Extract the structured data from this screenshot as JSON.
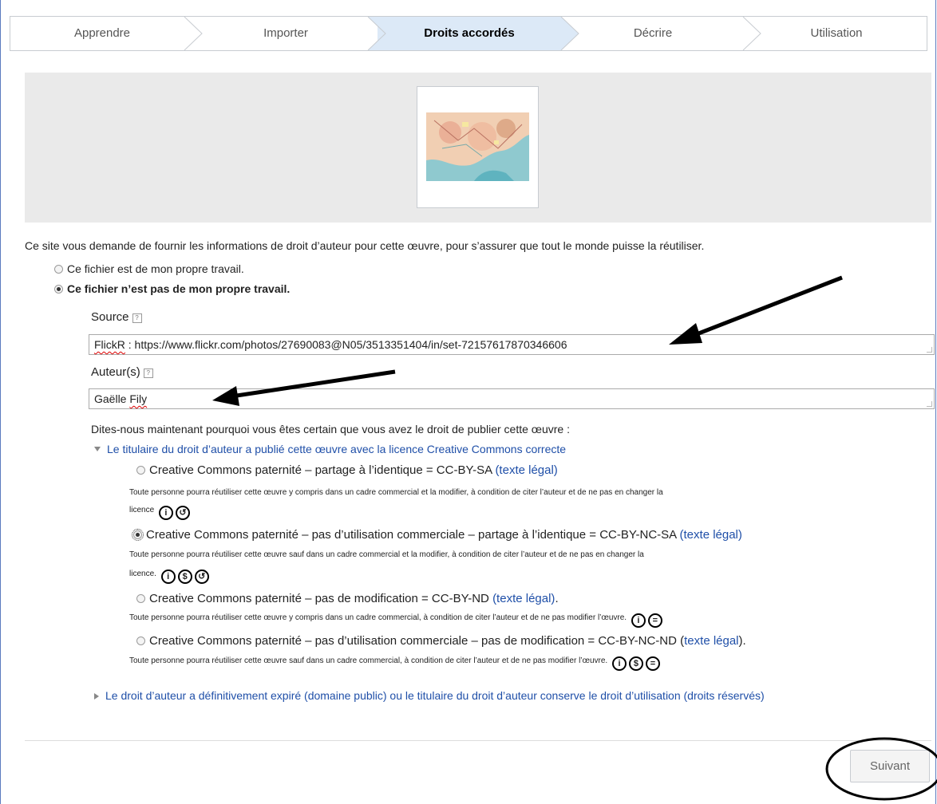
{
  "steps": [
    {
      "label": "Apprendre"
    },
    {
      "label": "Importer"
    },
    {
      "label": "Droits accordés"
    },
    {
      "label": "Décrire"
    },
    {
      "label": "Utilisation"
    }
  ],
  "intro": "Ce site vous demande de fournir les informations de droit d’auteur pour cette œuvre, pour s’assurer que tout le monde puisse la réutiliser.",
  "own_work": "Ce fichier est de mon propre travail.",
  "not_own_work": "Ce fichier n’est pas de mon propre travail.",
  "source": {
    "label": "Source",
    "value_prefix": "FlickR",
    "value_rest": " : https://www.flickr.com/photos/27690083@N05/3513351404/in/set-72157617870346606"
  },
  "authors": {
    "label": "Auteur(s)",
    "value_prefix": "Gaëlle ",
    "value_name": "Fily"
  },
  "why": "Dites-nous maintenant pourquoi vous êtes certain que vous avez le droit de publier cette œuvre :",
  "cc_section": "Le titulaire du droit d’auteur a publié cette œuvre avec la licence Creative Commons correcte",
  "licenses": [
    {
      "title": "Creative Commons paternité – partage à l’identique = CC-BY-SA",
      "link": "(texte légal)",
      "desc1": "Toute personne pourra réutiliser cette œuvre y compris dans un cadre commercial et la modifier, à condition de citer l’auteur et de ne pas en changer la",
      "desc2": "licence"
    },
    {
      "title": "Creative Commons paternité – pas d’utilisation commerciale – partage à l’identique = CC-BY-NC-SA",
      "link": "(texte légal)",
      "desc1": "Toute personne pourra réutiliser cette œuvre sauf dans un cadre commercial et la modifier, à condition de citer l’auteur et de ne pas en changer la",
      "desc2": "licence."
    },
    {
      "title": "Creative Commons paternité – pas de modification = CC-BY-ND",
      "link": "(texte légal)",
      "after": ".",
      "desc1": "Toute personne pourra réutiliser cette œuvre y compris dans un cadre commercial, à condition de citer l’auteur et de ne pas modifier l’œuvre."
    },
    {
      "title": "Creative Commons paternité – pas d’utilisation commerciale – pas de modification = CC-BY-NC-ND",
      "link_open": "(",
      "link": "texte légal",
      "after": ").",
      "desc1": "Toute personne pourra réutiliser cette œuvre sauf dans un cadre commercial, à condition de citer l’auteur et de ne pas modifier l’œuvre."
    }
  ],
  "pd_section": "Le droit d’auteur a définitivement expiré (domaine public) ou le titulaire du droit d’auteur conserve le droit d’utilisation (droits réservés)",
  "next_button": "Suivant",
  "icons": {
    "help": "?",
    "cc_by": "by-icon",
    "cc_sa": "share-alike-icon",
    "cc_nc": "non-commercial-icon",
    "cc_nd": "no-derivatives-icon"
  }
}
